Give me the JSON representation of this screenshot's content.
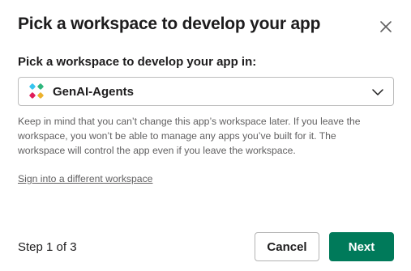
{
  "dialog": {
    "title": "Pick a workspace to develop your app",
    "close_icon": "close-icon"
  },
  "workspace_select": {
    "label": "Pick a workspace to develop your app in:",
    "selected_value": "GenAI-Agents",
    "logo_icon": "workspace-logo-icon",
    "chevron_icon": "chevron-down-icon"
  },
  "help_text": "Keep in mind that you can’t change this app’s workspace later. If you leave the workspace, you won’t be able to manage any apps you’ve built for it. The workspace will control the app even if you leave the workspace.",
  "alt_link": "Sign into a different workspace",
  "footer": {
    "step_text": "Step 1 of 3",
    "cancel_label": "Cancel",
    "next_label": "Next"
  },
  "colors": {
    "primary": "#007a5a",
    "text": "#1d1c1d",
    "muted_text": "#616061",
    "border": "#bcbcbc"
  }
}
